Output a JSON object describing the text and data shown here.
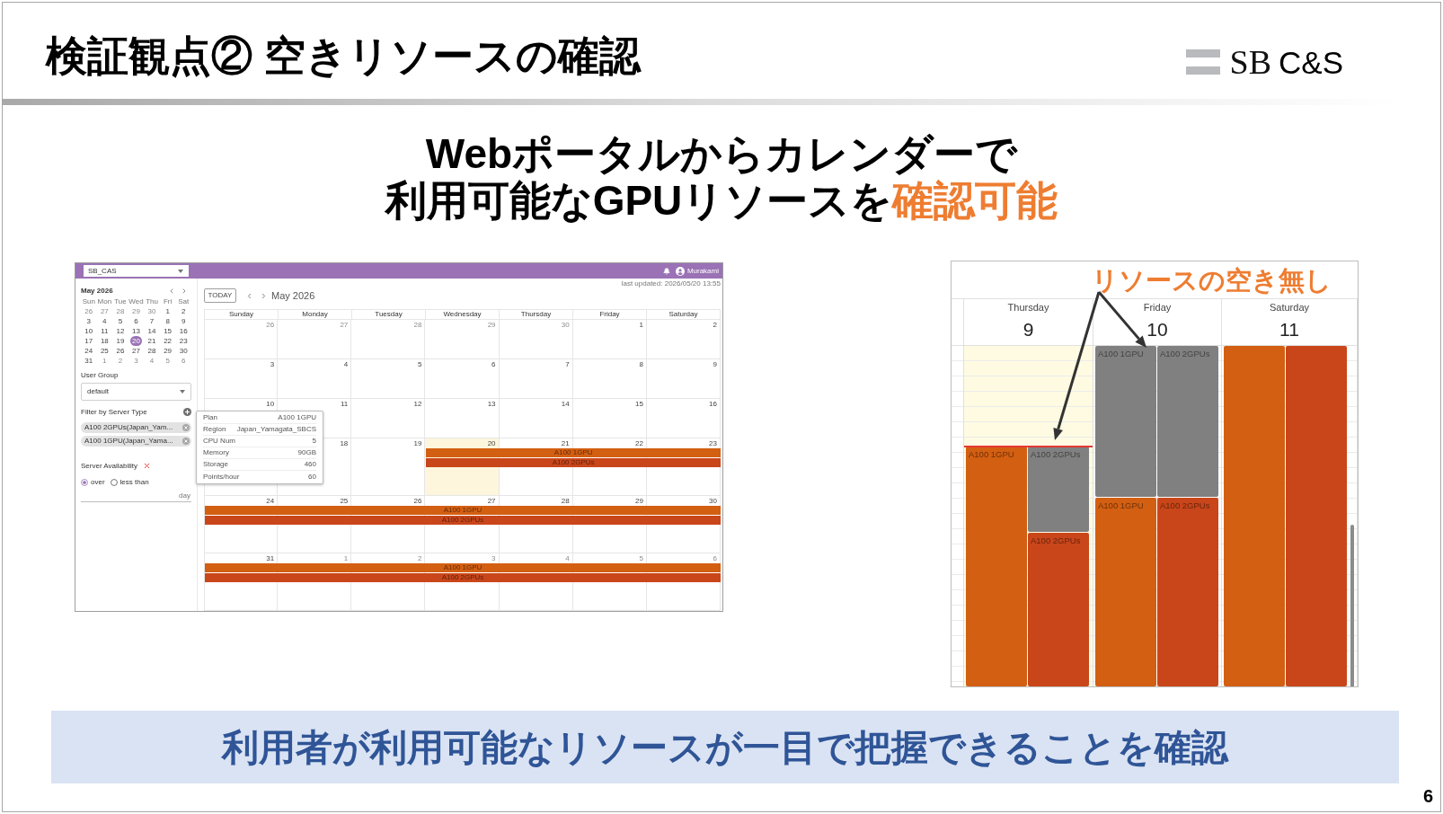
{
  "title": "検証観点② 空きリソースの確認",
  "logo": [
    {
      "text": "SB",
      "kind": "serif"
    },
    {
      "text": "C&S",
      "kind": "sans"
    }
  ],
  "headline": [
    [
      {
        "text": "Webポータルからカレンダーで",
        "highlight": false
      }
    ],
    [
      {
        "text": "利用可能なGPUリソースを",
        "highlight": false
      },
      {
        "text": "確認可能",
        "highlight": true
      }
    ]
  ],
  "portal_screenshot": {
    "top_bar": {
      "group_select": "SB_CAS",
      "user_name": "Murakami"
    },
    "sidebar": {
      "mini_calendar": {
        "title": "May 2026",
        "weekdays": [
          "Sun",
          "Mon",
          "Tue",
          "Wed",
          "Thu",
          "Fri",
          "Sat"
        ],
        "weeks": [
          [
            {
              "day": "26",
              "outside": true,
              "selected": false
            },
            {
              "day": "27",
              "outside": true,
              "selected": false
            },
            {
              "day": "28",
              "outside": true,
              "selected": false
            },
            {
              "day": "29",
              "outside": true,
              "selected": false
            },
            {
              "day": "30",
              "outside": true,
              "selected": false
            },
            {
              "day": "1",
              "outside": false,
              "selected": false
            },
            {
              "day": "2",
              "outside": false,
              "selected": false
            }
          ],
          [
            {
              "day": "3",
              "outside": false,
              "selected": false
            },
            {
              "day": "4",
              "outside": false,
              "selected": false
            },
            {
              "day": "5",
              "outside": false,
              "selected": false
            },
            {
              "day": "6",
              "outside": false,
              "selected": false
            },
            {
              "day": "7",
              "outside": false,
              "selected": false
            },
            {
              "day": "8",
              "outside": false,
              "selected": false
            },
            {
              "day": "9",
              "outside": false,
              "selected": false
            }
          ],
          [
            {
              "day": "10",
              "outside": false,
              "selected": false
            },
            {
              "day": "11",
              "outside": false,
              "selected": false
            },
            {
              "day": "12",
              "outside": false,
              "selected": false
            },
            {
              "day": "13",
              "outside": false,
              "selected": false
            },
            {
              "day": "14",
              "outside": false,
              "selected": false
            },
            {
              "day": "15",
              "outside": false,
              "selected": false
            },
            {
              "day": "16",
              "outside": false,
              "selected": false
            }
          ],
          [
            {
              "day": "17",
              "outside": false,
              "selected": false
            },
            {
              "day": "18",
              "outside": false,
              "selected": false
            },
            {
              "day": "19",
              "outside": false,
              "selected": false
            },
            {
              "day": "20",
              "outside": false,
              "selected": true
            },
            {
              "day": "21",
              "outside": false,
              "selected": false
            },
            {
              "day": "22",
              "outside": false,
              "selected": false
            },
            {
              "day": "23",
              "outside": false,
              "selected": false
            }
          ],
          [
            {
              "day": "24",
              "outside": false,
              "selected": false
            },
            {
              "day": "25",
              "outside": false,
              "selected": false
            },
            {
              "day": "26",
              "outside": false,
              "selected": false
            },
            {
              "day": "27",
              "outside": false,
              "selected": false
            },
            {
              "day": "28",
              "outside": false,
              "selected": false
            },
            {
              "day": "29",
              "outside": false,
              "selected": false
            },
            {
              "day": "30",
              "outside": false,
              "selected": false
            }
          ],
          [
            {
              "day": "31",
              "outside": false,
              "selected": false
            },
            {
              "day": "1",
              "outside": true,
              "selected": false
            },
            {
              "day": "2",
              "outside": true,
              "selected": false
            },
            {
              "day": "3",
              "outside": true,
              "selected": false
            },
            {
              "day": "4",
              "outside": true,
              "selected": false
            },
            {
              "day": "5",
              "outside": true,
              "selected": false
            },
            {
              "day": "6",
              "outside": true,
              "selected": false
            }
          ]
        ]
      },
      "user_group": {
        "label": "User Group",
        "value": "default"
      },
      "server_filter": {
        "label": "Filter by Server Type",
        "chips": [
          "A100 2GPUs(Japan_Yam...",
          "A100 1GPU(Japan_Yama..."
        ]
      },
      "availability": {
        "label": "Server Availability",
        "options": [
          {
            "label": "over",
            "selected": true
          },
          {
            "label": "less than",
            "selected": false
          }
        ],
        "unit": "day"
      }
    },
    "toolbar": {
      "last_updated": "last updated: 2026/05/20 13:55",
      "today_button": "TODAY",
      "month": "May 2026"
    },
    "calendar": {
      "day_headers": [
        "Sunday",
        "Monday",
        "Tuesday",
        "Wednesday",
        "Thursday",
        "Friday",
        "Saturday"
      ],
      "weeks": [
        {
          "days": [
            {
              "date": "26",
              "outside": true,
              "today": false
            },
            {
              "date": "27",
              "outside": true,
              "today": false
            },
            {
              "date": "28",
              "outside": true,
              "today": false
            },
            {
              "date": "29",
              "outside": true,
              "today": false
            },
            {
              "date": "30",
              "outside": true,
              "today": false
            },
            {
              "date": "1",
              "outside": false,
              "today": false
            },
            {
              "date": "2",
              "outside": false,
              "today": false
            }
          ]
        },
        {
          "days": [
            {
              "date": "3",
              "outside": false,
              "today": false
            },
            {
              "date": "4",
              "outside": false,
              "today": false
            },
            {
              "date": "5",
              "outside": false,
              "today": false
            },
            {
              "date": "6",
              "outside": false,
              "today": false
            },
            {
              "date": "7",
              "outside": false,
              "today": false
            },
            {
              "date": "8",
              "outside": false,
              "today": false
            },
            {
              "date": "9",
              "outside": false,
              "today": false
            }
          ]
        },
        {
          "days": [
            {
              "date": "10",
              "outside": false,
              "today": false
            },
            {
              "date": "11",
              "outside": false,
              "today": false
            },
            {
              "date": "12",
              "outside": false,
              "today": false
            },
            {
              "date": "13",
              "outside": false,
              "today": false
            },
            {
              "date": "14",
              "outside": false,
              "today": false
            },
            {
              "date": "15",
              "outside": false,
              "today": false
            },
            {
              "date": "16",
              "outside": false,
              "today": false
            }
          ]
        },
        {
          "days": [
            {
              "today": false
            },
            {
              "date": "18",
              "outside": false,
              "today": false,
              "booked": false
            },
            {
              "date": "19",
              "outside": false,
              "today": false,
              "booked": false
            },
            {
              "date": "20",
              "outside": false,
              "today": true,
              "booked": true
            },
            {
              "date": "21",
              "outside": false,
              "today": false,
              "booked": true
            },
            {
              "date": "22",
              "outside": false,
              "today": false,
              "booked": true
            },
            {
              "date": "23",
              "outside": false,
              "today": false,
              "booked": true
            }
          ],
          "events": [
            {
              "label": "A100 1GPU",
              "color": "#d35f12"
            },
            {
              "label": "A100 2GPUs",
              "color": "#c9461a"
            }
          ]
        },
        {
          "days": [
            {
              "date": "24",
              "outside": false,
              "today": false,
              "booked": true
            },
            {
              "date": "25",
              "outside": false,
              "today": false,
              "booked": true
            },
            {
              "date": "26",
              "outside": false,
              "today": false,
              "booked": true
            },
            {
              "date": "27",
              "outside": false,
              "today": false,
              "booked": true
            },
            {
              "date": "28",
              "outside": false,
              "today": false,
              "booked": true
            },
            {
              "date": "29",
              "outside": false,
              "today": false,
              "booked": true
            },
            {
              "date": "30",
              "outside": false,
              "today": false,
              "booked": true
            }
          ],
          "events": [
            {
              "label": "A100 1GPU",
              "color": "#d35f12"
            },
            {
              "label": "A100 2GPUs",
              "color": "#c9461a"
            }
          ]
        },
        {
          "days": [
            {
              "date": "31",
              "outside": false,
              "today": false,
              "booked": true
            },
            {
              "date": "1",
              "outside": true,
              "today": false,
              "booked": true
            },
            {
              "date": "2",
              "outside": true,
              "today": false,
              "booked": true
            },
            {
              "date": "3",
              "outside": true,
              "today": false,
              "booked": true
            },
            {
              "date": "4",
              "outside": true,
              "today": false,
              "booked": true
            },
            {
              "date": "5",
              "outside": true,
              "today": false,
              "booked": true
            },
            {
              "date": "6",
              "outside": true,
              "today": false,
              "booked": true
            }
          ],
          "events": [
            {
              "label": "A100 1GPU",
              "color": "#d35f12"
            },
            {
              "label": "A100 2GPUs",
              "color": "#c9461a"
            }
          ]
        }
      ]
    },
    "tooltip": {
      "rows": [
        {
          "label": "Plan",
          "value": "A100 1GPU"
        },
        {
          "label": "Region",
          "value": "Japan_Yamagata_SBCS"
        },
        {
          "label": "CPU Num",
          "value": "5"
        },
        {
          "label": "Memory",
          "value": "90GB"
        },
        {
          "label": "Storage",
          "value": "460"
        },
        {
          "label": "Points/hour",
          "value": "60"
        }
      ]
    }
  },
  "week_view_screenshot": {
    "annotation": "リソースの空き無し",
    "days": [
      {
        "weekday": "Thursday",
        "date": "9",
        "today": true,
        "now_line": true,
        "lanes": [
          {
            "events": [
              {
                "label": "A100 1GPU",
                "color": "#d35f12"
              }
            ]
          },
          {
            "events": [
              {
                "label": "A100 2GPUs",
                "color": "#808080"
              },
              {
                "label": "A100 2GPUs",
                "color": "#c9461a"
              }
            ]
          }
        ]
      },
      {
        "weekday": "Friday",
        "date": "10",
        "today": false,
        "now_line": false,
        "lanes": [
          {
            "events": [
              {
                "label": "A100 1GPU",
                "color": "#808080"
              },
              {
                "label": "A100 1GPU",
                "color": "#d35f12"
              }
            ]
          },
          {
            "events": [
              {
                "label": "A100 2GPUs",
                "color": "#808080"
              },
              {
                "label": "A100 2GPUs",
                "color": "#c9461a"
              }
            ]
          }
        ]
      },
      {
        "weekday": "Saturday",
        "date": "11",
        "today": false,
        "now_line": false,
        "lanes": [
          {
            "events": [
              {
                "color": "#d35f12"
              }
            ]
          },
          {
            "events": [
              {
                "color": "#c9461a"
              }
            ]
          }
        ]
      }
    ]
  },
  "summary": "利用者が利用可能なリソースが一目で把握できることを確認",
  "page_number": "6"
}
